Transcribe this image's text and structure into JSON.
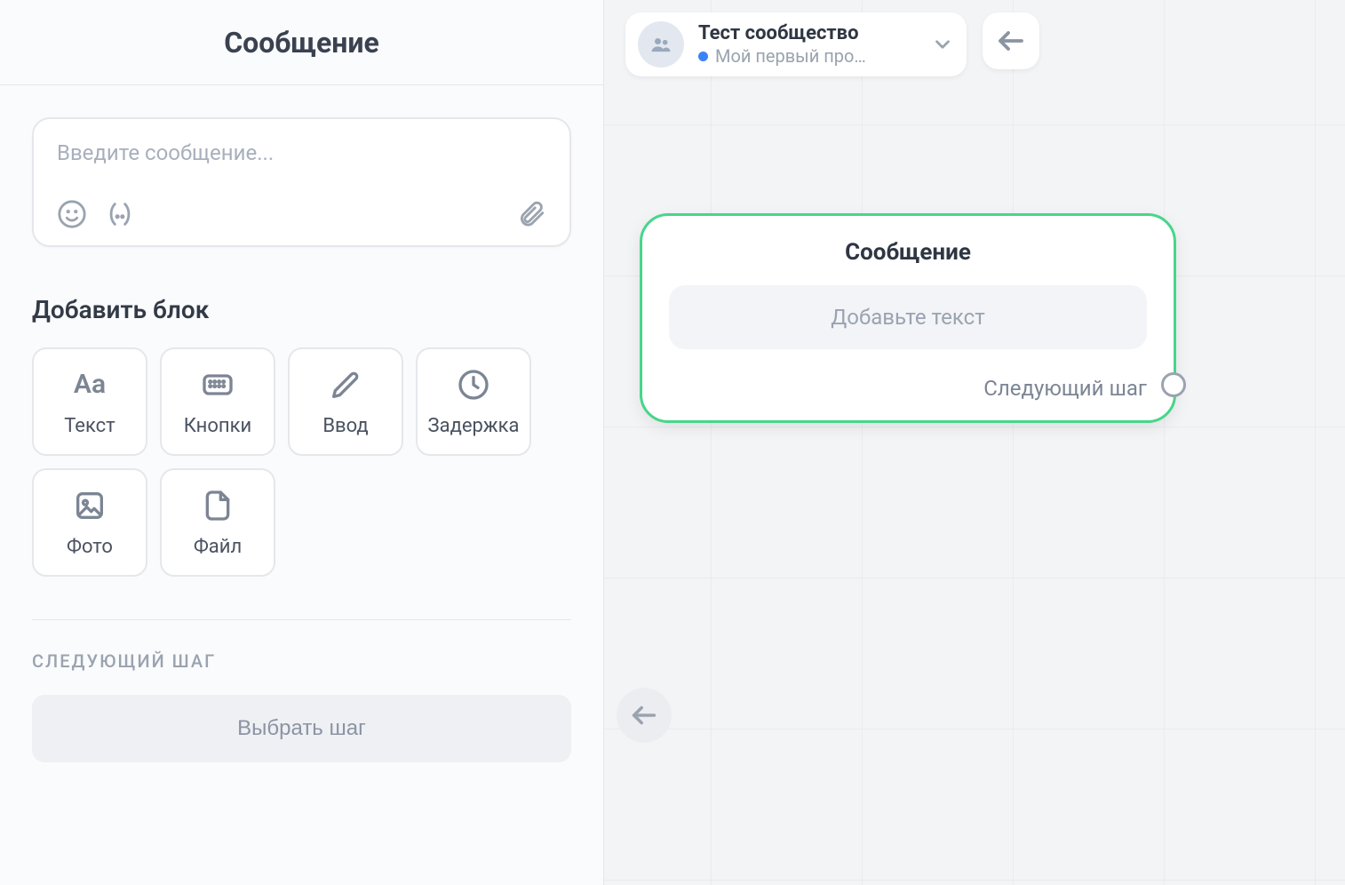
{
  "panel": {
    "title": "Сообщение",
    "message_placeholder": "Введите сообщение...",
    "add_block_heading": "Добавить блок",
    "blocks": {
      "text": {
        "label": "Текст",
        "icon_text": "Aa"
      },
      "buttons": {
        "label": "Кнопки"
      },
      "input": {
        "label": "Ввод"
      },
      "delay": {
        "label": "Задержка"
      },
      "photo": {
        "label": "Фото"
      },
      "file": {
        "label": "Файл"
      }
    },
    "next_step_heading": "СЛЕДУЮЩИЙ ШАГ",
    "choose_step_label": "Выбрать шаг"
  },
  "context": {
    "community_name": "Тест сообщество",
    "project_name": "Мой первый про…"
  },
  "node": {
    "title": "Сообщение",
    "placeholder": "Добавьте текст",
    "next_label": "Следующий шаг"
  },
  "colors": {
    "accent_green": "#46d68a",
    "status_blue": "#3b82f6"
  }
}
